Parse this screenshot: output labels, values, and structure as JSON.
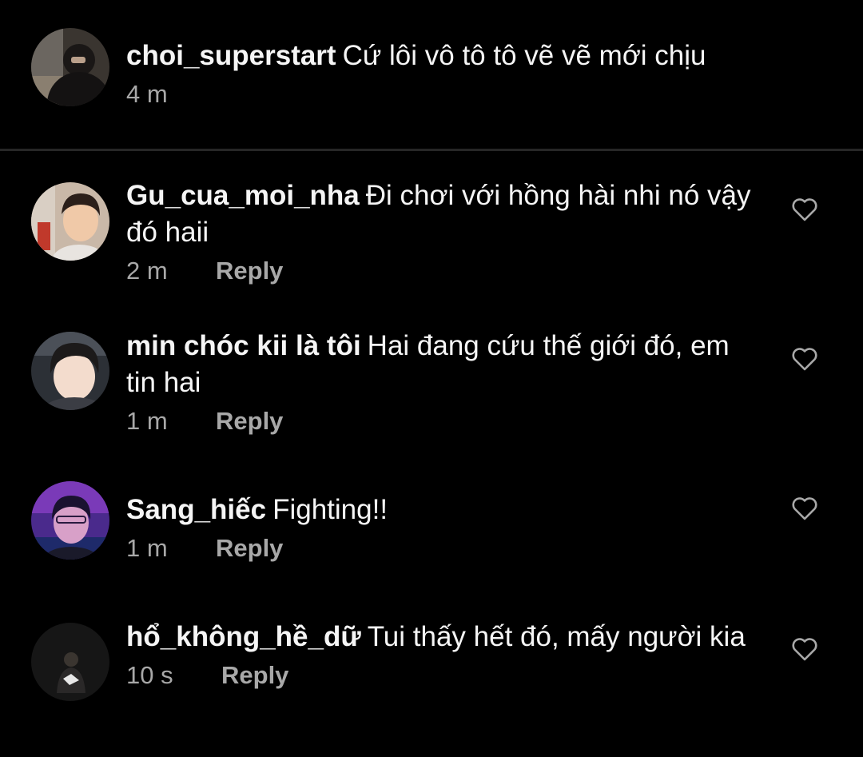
{
  "caption": {
    "username": "choi_superstart",
    "text": "Cứ lôi vô tô tô vẽ vẽ mới chịu",
    "time": "4 m"
  },
  "comments": [
    {
      "username": "Gu_cua_moi_nha",
      "text": "Đi chơi với hồng hài nhi nó vậy đó haii",
      "time": "2 m",
      "reply_label": "Reply"
    },
    {
      "username": "min chóc kii là tôi",
      "text": "Hai đang cứu thế giới đó, em tin hai",
      "time": "1 m",
      "reply_label": "Reply"
    },
    {
      "username": "Sang_hiếc",
      "text": "Fighting!!",
      "time": "1 m",
      "reply_label": "Reply"
    },
    {
      "username": "hổ_không_hề_dữ",
      "text": "Tui thấy hết đó, mấy người kia",
      "time": "10 s",
      "reply_label": "Reply"
    }
  ],
  "icons": {
    "like": "heart-outline-icon"
  },
  "colors": {
    "background": "#000000",
    "primary_text": "#f5f5f5",
    "secondary_text": "#a8a8a8",
    "divider": "#262626"
  }
}
